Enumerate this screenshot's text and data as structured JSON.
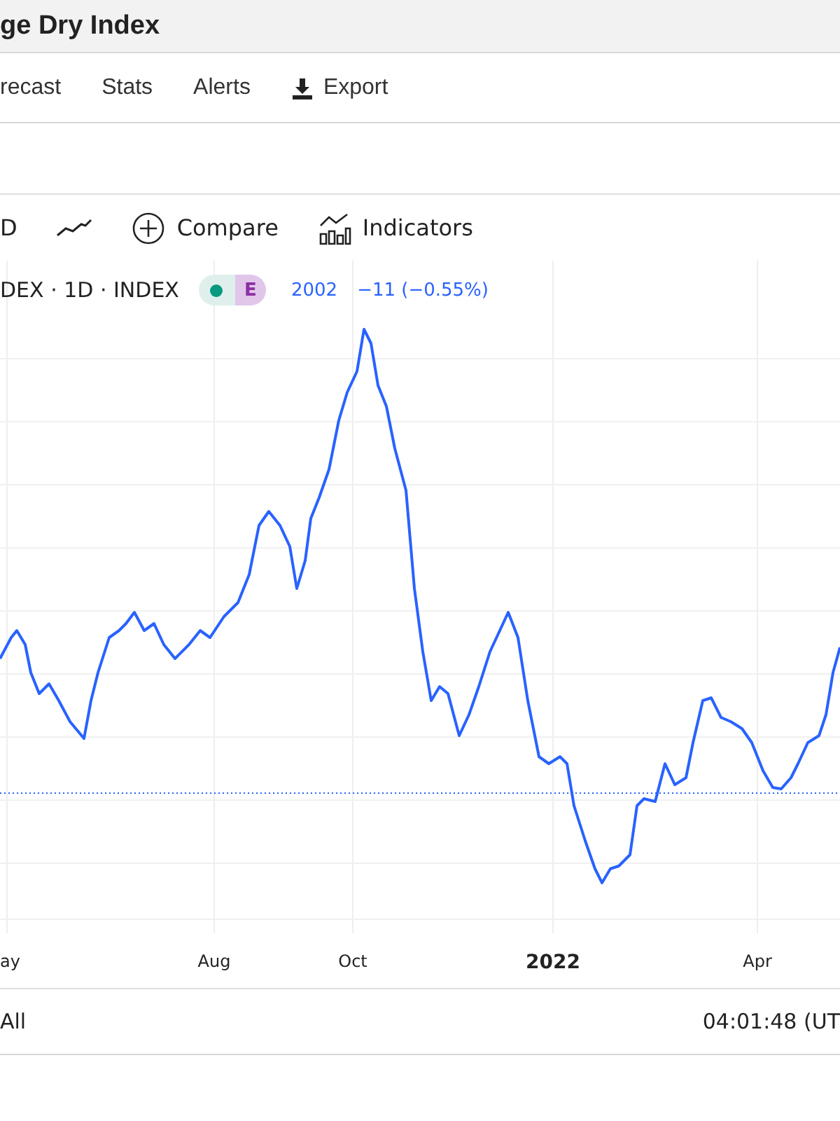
{
  "window": {
    "title": "ge Dry Index"
  },
  "nav": {
    "items": [
      {
        "label": "recast",
        "kind": "text"
      },
      {
        "label": "Stats",
        "kind": "text"
      },
      {
        "label": "Alerts",
        "kind": "text"
      },
      {
        "label": "Export",
        "kind": "download"
      }
    ]
  },
  "toolbar": {
    "interval": "D",
    "compare": "Compare",
    "indicators": "Indicators"
  },
  "legend": {
    "symbol": "DEX · 1D · INDEX",
    "badge": "E",
    "price": "2002",
    "change": "−11 (−0.55%)"
  },
  "x_axis": {
    "labels": [
      {
        "text": "ay",
        "bold": false
      },
      {
        "text": "Aug",
        "bold": false
      },
      {
        "text": "Oct",
        "bold": false
      },
      {
        "text": "2022",
        "bold": true
      },
      {
        "text": "Apr",
        "bold": false
      }
    ]
  },
  "footer": {
    "range": "All",
    "time": "04:01:48 (UT"
  }
}
